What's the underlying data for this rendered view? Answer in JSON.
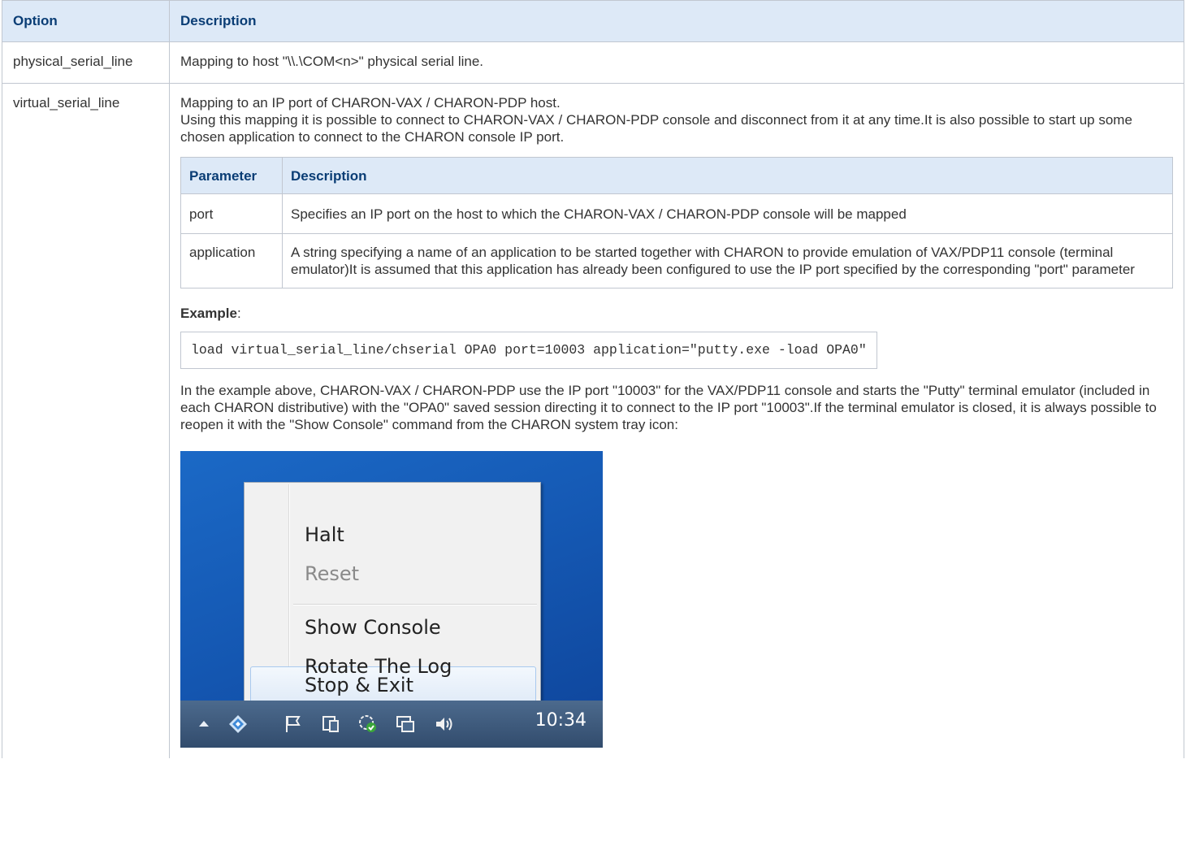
{
  "table": {
    "headers": [
      "Option",
      "Description"
    ],
    "rows": [
      {
        "option": "physical_serial_line",
        "description": "Mapping to host \"\\\\.\\COM<n>\" physical serial line."
      },
      {
        "option": "virtual_serial_line",
        "description_line1": "Mapping to an IP port of CHARON-VAX / CHARON-PDP host.",
        "description_line2": "Using this mapping it is possible to connect to CHARON-VAX / CHARON-PDP console and disconnect from it at any time.It is also possible to start up some chosen application to connect to the CHARON console IP port."
      }
    ]
  },
  "param_table": {
    "headers": [
      "Parameter",
      "Description"
    ],
    "rows": [
      {
        "name": "port",
        "description": "Specifies an IP port on the host to which the CHARON-VAX / CHARON-PDP console will be mapped"
      },
      {
        "name": "application",
        "description": "A string specifying a name of an application to be started together with CHARON to provide emulation of VAX/PDP11 console (terminal emulator)It is assumed that this application has already been configured to use the IP port specified by the corresponding \"port\" parameter"
      }
    ]
  },
  "example": {
    "label": "Example",
    "suffix": ":",
    "code": "load virtual_serial_line/chserial OPA0 port=10003 application=\"putty.exe -load OPA0\"",
    "explanation": "In the example above, CHARON-VAX / CHARON-PDP use the IP port \"10003\" for the VAX/PDP11 console and starts the \"Putty\" terminal emulator (included in each CHARON distributive) with the \"OPA0\" saved session directing it to connect to the IP port \"10003\".If the terminal emulator is closed, it is always possible to reopen it with the \"Show Console\" command from the CHARON system tray icon:"
  },
  "screenshot": {
    "menu_items": [
      "Halt",
      "Reset",
      "Show Console",
      "Rotate The Log",
      "Stop & Exit"
    ],
    "clock": "10:34",
    "tray_icons": [
      "show-hidden-icon",
      "charon-icon",
      "flag-icon",
      "network-device-icon",
      "security-shield-icon",
      "network-icon",
      "speaker-icon"
    ]
  }
}
